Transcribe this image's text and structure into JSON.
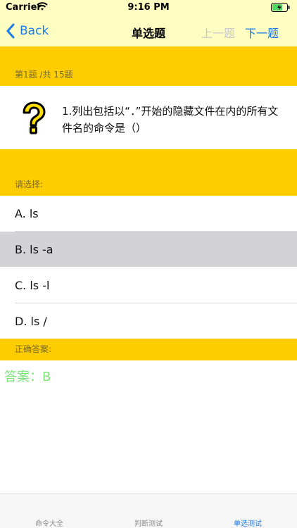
{
  "status_bar": {
    "carrier": "Carrier",
    "time": "9:16 PM"
  },
  "nav": {
    "back_label": "Back",
    "title": "单选题",
    "prev_label": "上一题",
    "next_label": "下一题"
  },
  "question": {
    "progress": "第1题 /共 15题",
    "text": "1.列出包括以“．”开始的隐藏文件在内的所有文件名的命令是（）"
  },
  "choose_label": "请选择:",
  "options": [
    {
      "label": "A. ls"
    },
    {
      "label": "B. ls -a"
    },
    {
      "label": "C. ls -l"
    },
    {
      "label": "D. ls /"
    }
  ],
  "answer": {
    "header": "正确答案:",
    "text": "答案：B"
  },
  "tabs": [
    {
      "label": "命令大全"
    },
    {
      "label": "判断测试"
    },
    {
      "label": "单选测试"
    }
  ],
  "colors": {
    "accent": "#1a7bea",
    "band": "#fecd00",
    "nav_bg": "#fefdc2",
    "answer": "#7ee37a",
    "selected_bg": "#d2d2d7"
  }
}
